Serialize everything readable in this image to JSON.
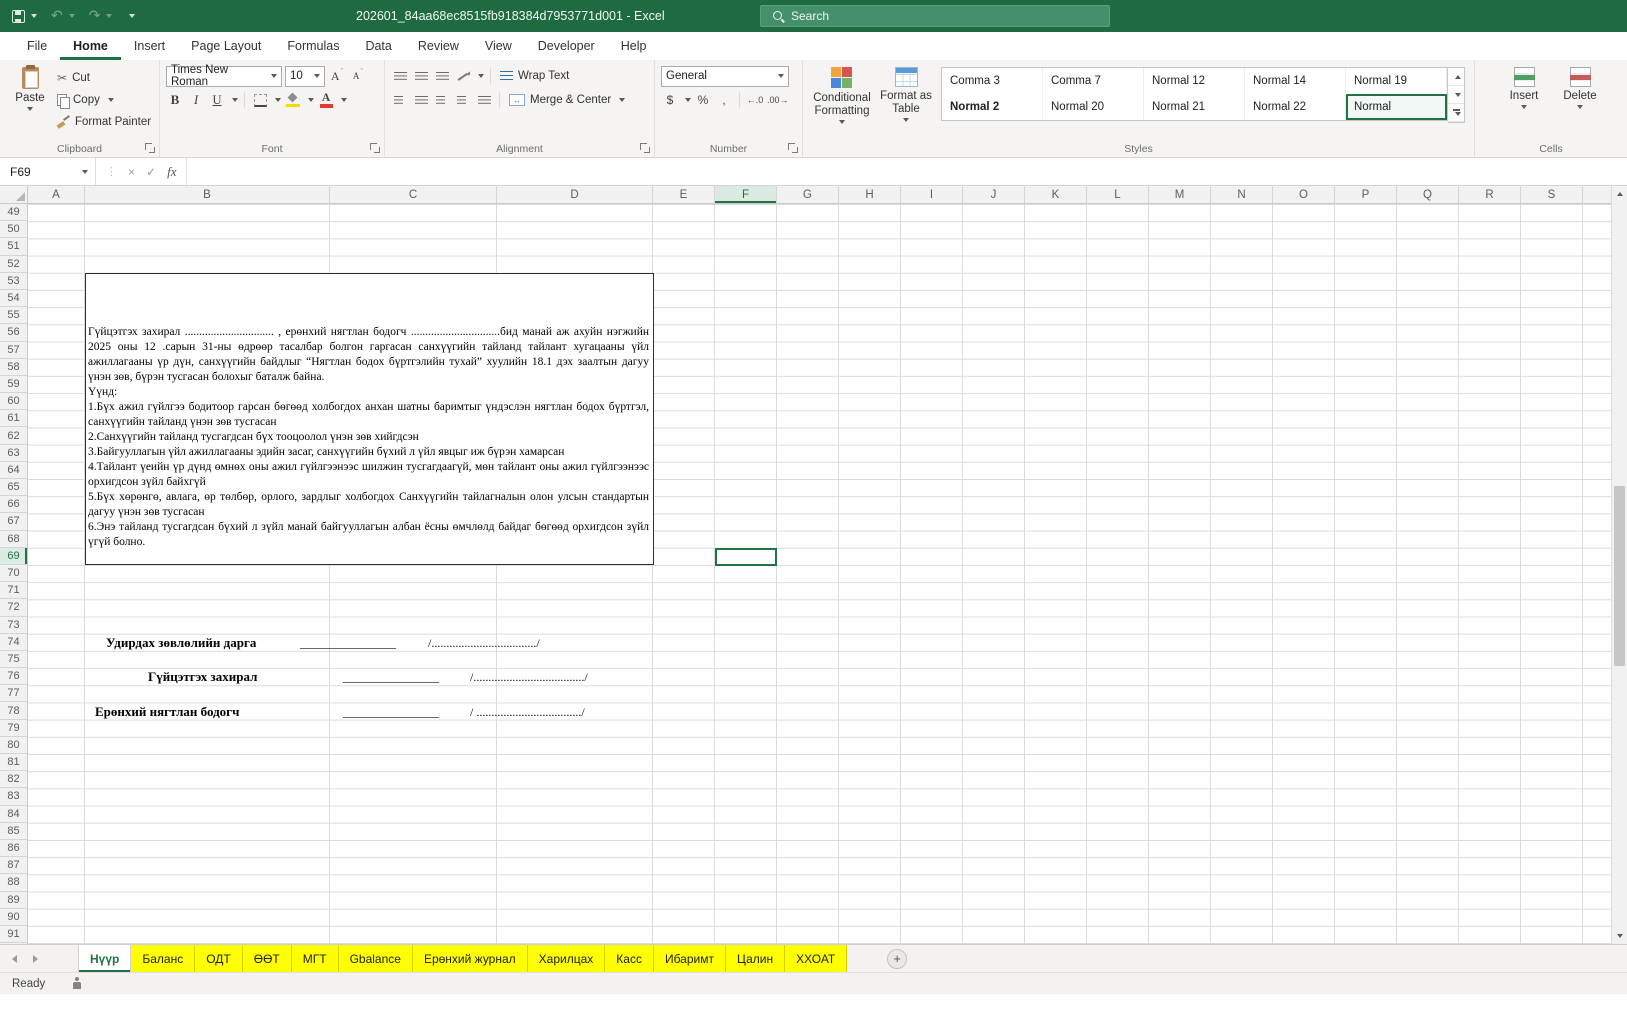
{
  "titlebar": {
    "title": "202601_84aa68ec8515fb918384d7953771d001 - Excel",
    "search_placeholder": "Search"
  },
  "ribbon": {
    "tabs": [
      "File",
      "Home",
      "Insert",
      "Page Layout",
      "Formulas",
      "Data",
      "Review",
      "View",
      "Developer",
      "Help"
    ],
    "active_tab": "Home",
    "clipboard": {
      "label": "Clipboard",
      "paste": "Paste",
      "cut": "Cut",
      "copy": "Copy",
      "format_painter": "Format Painter"
    },
    "font": {
      "label": "Font",
      "name": "Times New Roman",
      "size": "10"
    },
    "alignment": {
      "label": "Alignment",
      "wrap_text": "Wrap Text",
      "merge_center": "Merge & Center"
    },
    "number": {
      "label": "Number",
      "format": "General"
    },
    "styles_group": {
      "label": "Styles",
      "cond_format": "Conditional Formatting",
      "format_table": "Format as Table",
      "row1": [
        "Comma 3",
        "Comma 7",
        "Normal 12",
        "Normal 14",
        "Normal 19"
      ],
      "row2": [
        "Normal 2",
        "Normal 20",
        "Normal 21",
        "Normal 22",
        "Normal"
      ],
      "selected": "Normal"
    },
    "cells": {
      "label": "Cells",
      "insert": "Insert",
      "delete": "Delete"
    }
  },
  "formula_bar": {
    "name_box": "F69",
    "formula": ""
  },
  "grid": {
    "columns": [
      "A",
      "B",
      "C",
      "D",
      "E",
      "F",
      "G",
      "H",
      "I",
      "J",
      "K",
      "L",
      "M",
      "N",
      "O",
      "P",
      "Q",
      "R",
      "S"
    ],
    "row_start": 49,
    "row_end": 91,
    "active_col": "F",
    "active_row": 69
  },
  "document": {
    "intro": "Гүйцэтгэх захирал ............................... , ерөнхий нягтлан бодогч ...............................бид манай аж ахуйн нэгжийн 2025 оны 12 .сарын 31-ны өдрөөр тасалбар болгон гаргасан санхүүгийн тайланд тайлант хугацааны үйл ажиллагааны үр дүн, санхүүгийн байдлыг “Нягтлан бодох бүртгэлийн тухай” хуулийн 18.1 дэх заалтын дагуу үнэн зөв, бүрэн тусгасан болохыг баталж байна.",
    "heading": "Үүнд:",
    "items": [
      "1.Бүх ажил гүйлгээ бодитоор гарсан бөгөөд холбогдох анхан шатны баримтыг үндэслэн нягтлан бодох бүртгэл, санхүүгийн тайланд үнэн зөв тусгасан",
      "2.Санхүүгийн тайланд тусгагдсан бүх тооцоолол үнэн зөв хийгдсэн",
      "3.Байгууллагын үйл ажиллагааны эдийн засаг, санхүүгийн бүхий л үйл явцыг иж бүрэн хамарсан",
      "4.Тайлант үеийн үр дүнд өмнөх оны ажил гүйлгээнээс шилжин тусгагдаагүй, мөн тайлант оны ажил гүйлгээнээс орхигдсон зүйл байхгүй",
      "5.Бүх хөрөнгө, авлага, өр төлбөр, орлого, зардлыг холбогдох Санхүүгийн тайлагналын олон улсын стандартын дагуу үнэн зөв тусгасан",
      "6.Энэ тайланд тусгагдсан бүхий л зүйл манай байгууллагын албан ёсны өмчлөлд байдаг бөгөөд орхигдсон зүйл үгүй болно."
    ],
    "signatures": [
      {
        "label": "Удирдах зөвлөлийн дарга",
        "line": "________________",
        "dots": "/.................................../"
      },
      {
        "label": "Гүйцэтгэх захирал",
        "line": "________________",
        "dots": "/...................................../"
      },
      {
        "label": "Ерөнхий нягтлан бодогч",
        "line": "________________",
        "dots": "/ .................................../"
      }
    ]
  },
  "sheet_tabs": {
    "active": "Нүүр",
    "tabs": [
      "Нүүр",
      "Баланс",
      "ОДТ",
      "ӨӨТ",
      "МГТ",
      "Gbalance",
      "Ерөнхий журнал",
      "Харилцах",
      "Касс",
      "Ибаримт",
      "Цалин",
      "ХХОАТ"
    ]
  },
  "status_bar": {
    "status": "Ready"
  }
}
